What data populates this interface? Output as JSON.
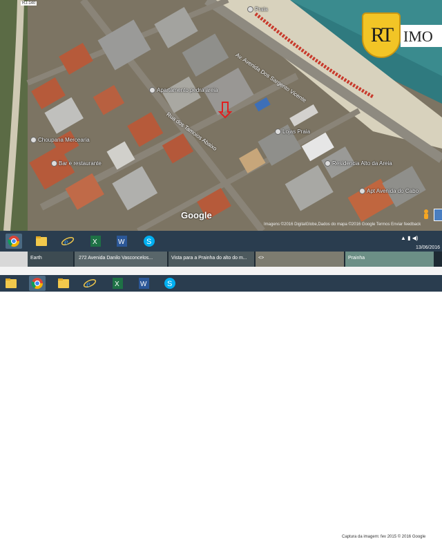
{
  "map": {
    "labels": {
      "praia": "Praia",
      "apartamento": "Apartamento pedra areia",
      "lojas": "Lojas Praia",
      "choupana": "Choupana Mercearia",
      "bar": "Bar e restaurante",
      "residencia": "Residencia Alto da Areia",
      "apart_hotel": "Apt Avenida do Cabo",
      "highway": "RJ-140"
    },
    "roads": {
      "avenida": "Av. Avenida Dos Sargento Vicente",
      "rua": "Rua dos Tamoios Abaixo"
    },
    "google_label": "Google",
    "attribution": "Imagens ©2016 DigitalGlobe,Dados do mapa ©2016 Google    Termos    Enviar feedback"
  },
  "logo": {
    "monogram": "RT",
    "suffix": "IMO"
  },
  "taskbar1": {
    "apps": [
      "chrome-icon",
      "folder-icon",
      "internet-explorer-icon",
      "excel-icon",
      "word-icon",
      "skype-icon"
    ],
    "date": "13/06/2016"
  },
  "strip": {
    "items": [
      {
        "caption": "Earth"
      },
      {
        "caption": "272 Avenida Danilo Vasconcelos..."
      },
      {
        "caption": "Vista para a Prainha do alto do m..."
      },
      {
        "caption": "<>"
      },
      {
        "caption": "Prainha"
      }
    ],
    "capture": "Captura da imagem: fev 2015    © 2016 Google"
  },
  "taskbar2": {
    "apps": [
      "folder-icon",
      "chrome-icon",
      "folder-icon",
      "internet-explorer-icon",
      "excel-icon",
      "word-icon",
      "skype-icon"
    ]
  },
  "colors": {
    "taskbar": "#2a3d4f",
    "sea": "#2f7a7f",
    "sand": "#d8d2bd"
  }
}
